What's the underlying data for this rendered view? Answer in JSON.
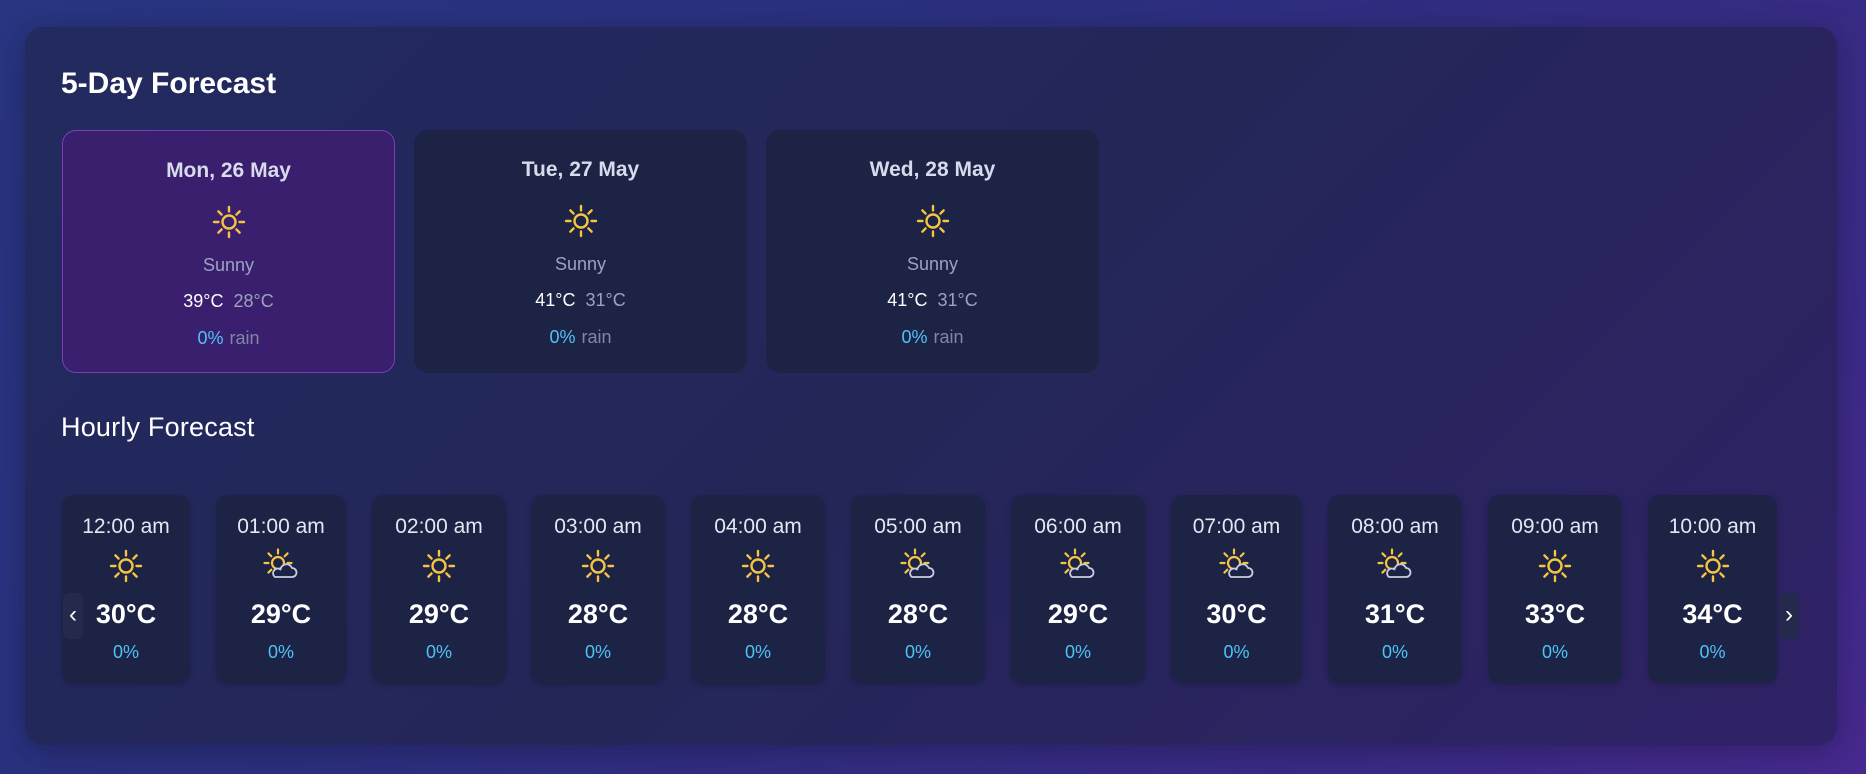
{
  "titles": {
    "five_day": "5-Day Forecast",
    "hourly": "Hourly Forecast"
  },
  "colors": {
    "accent_rain": "#4fc3f7",
    "sun": "#f5c542",
    "selected_card": "#3a1f6e"
  },
  "days": [
    {
      "date": "Mon, 26 May",
      "icon": "sun-icon",
      "condition": "Sunny",
      "high": "39°C",
      "low": "28°C",
      "rain_pct": "0%",
      "rain_word": "rain",
      "selected": true
    },
    {
      "date": "Tue, 27 May",
      "icon": "sun-icon",
      "condition": "Sunny",
      "high": "41°C",
      "low": "31°C",
      "rain_pct": "0%",
      "rain_word": "rain",
      "selected": false
    },
    {
      "date": "Wed, 28 May",
      "icon": "sun-icon",
      "condition": "Sunny",
      "high": "41°C",
      "low": "31°C",
      "rain_pct": "0%",
      "rain_word": "rain",
      "selected": false
    }
  ],
  "hours": [
    {
      "time": "12:00 am",
      "icon": "sun-icon",
      "temp": "30°C",
      "rain": "0%"
    },
    {
      "time": "01:00 am",
      "icon": "partly-cloudy-icon",
      "temp": "29°C",
      "rain": "0%"
    },
    {
      "time": "02:00 am",
      "icon": "sun-icon",
      "temp": "29°C",
      "rain": "0%"
    },
    {
      "time": "03:00 am",
      "icon": "sun-icon",
      "temp": "28°C",
      "rain": "0%"
    },
    {
      "time": "04:00 am",
      "icon": "sun-icon",
      "temp": "28°C",
      "rain": "0%"
    },
    {
      "time": "05:00 am",
      "icon": "partly-cloudy-icon",
      "temp": "28°C",
      "rain": "0%"
    },
    {
      "time": "06:00 am",
      "icon": "partly-cloudy-icon",
      "temp": "29°C",
      "rain": "0%"
    },
    {
      "time": "07:00 am",
      "icon": "partly-cloudy-icon",
      "temp": "30°C",
      "rain": "0%"
    },
    {
      "time": "08:00 am",
      "icon": "partly-cloudy-icon",
      "temp": "31°C",
      "rain": "0%"
    },
    {
      "time": "09:00 am",
      "icon": "sun-icon",
      "temp": "33°C",
      "rain": "0%"
    },
    {
      "time": "10:00 am",
      "icon": "sun-icon",
      "temp": "34°C",
      "rain": "0%"
    }
  ],
  "nav": {
    "prev": "‹",
    "next": "›"
  }
}
